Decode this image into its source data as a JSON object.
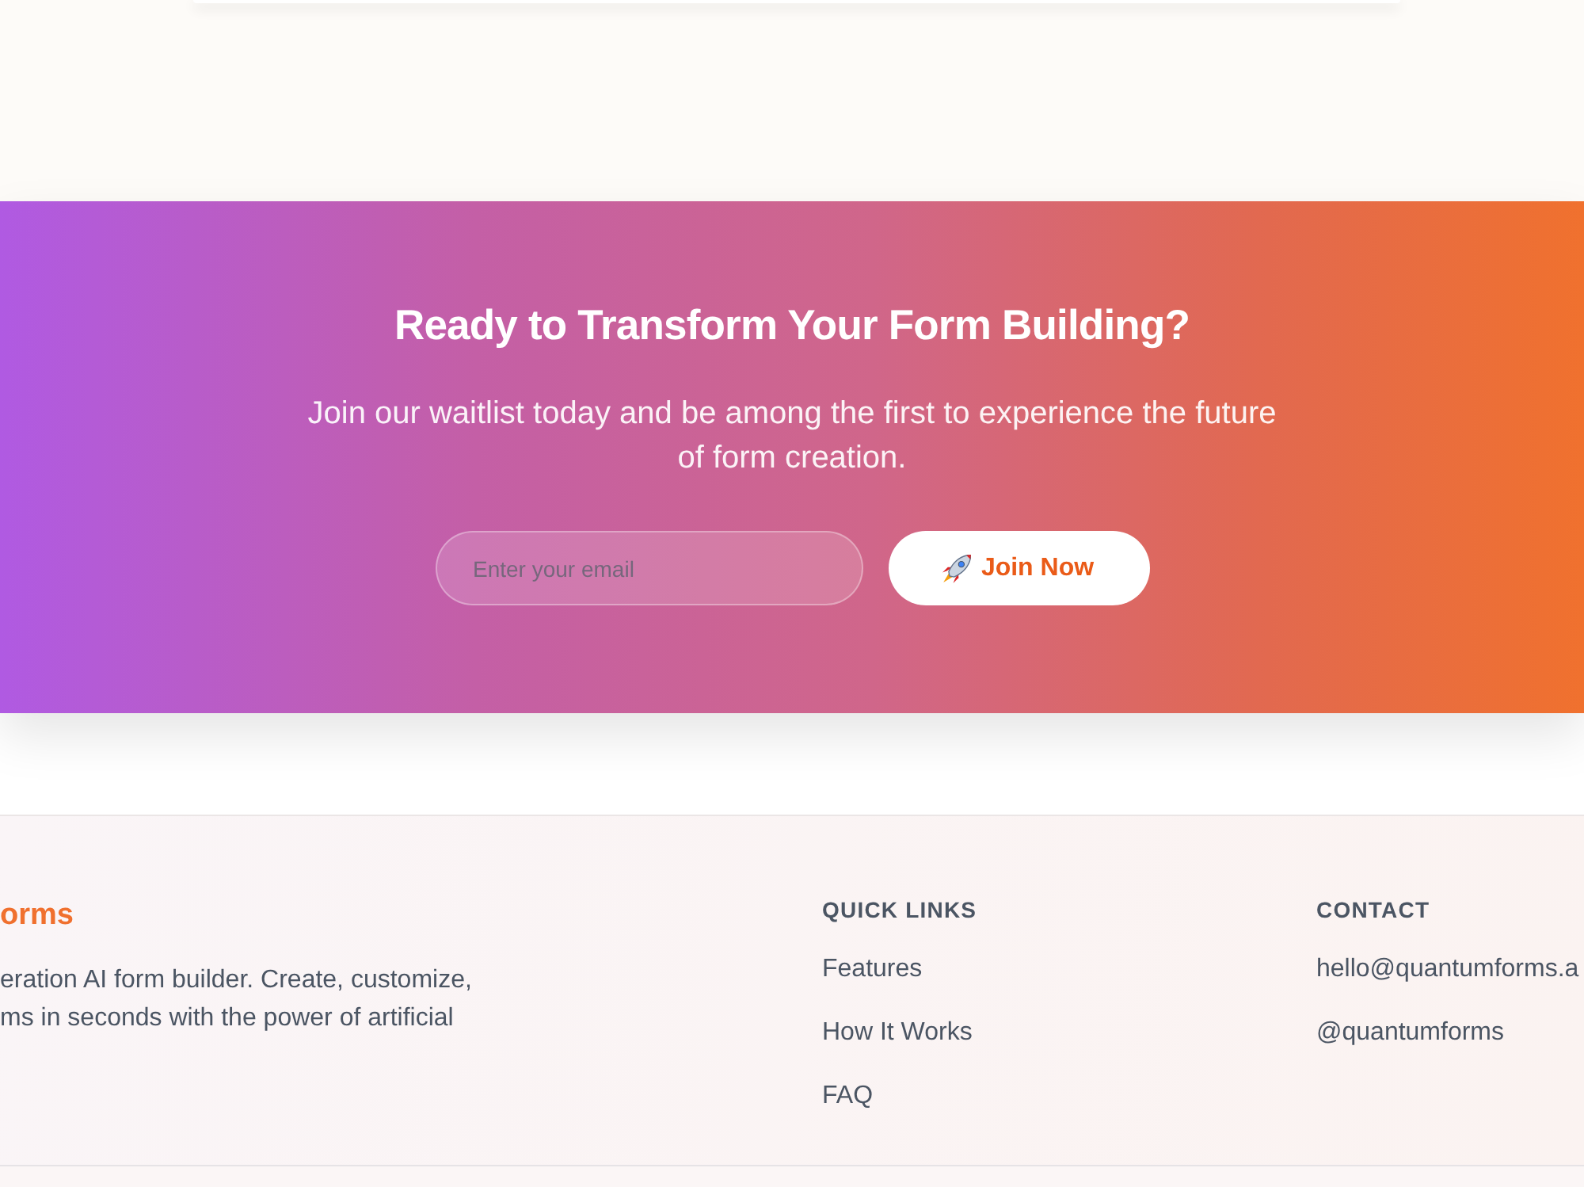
{
  "cta": {
    "title": "Ready to Transform Your Form Building?",
    "subtitle": "Join our waitlist today and be among the first to experience the future of form creation.",
    "email_field": {
      "placeholder": "Enter your email"
    },
    "join_button": {
      "label": "Join Now"
    }
  },
  "footer": {
    "brand": "orms",
    "description_lines": [
      "eration AI form builder. Create, customize,",
      "ms in seconds with the power of artificial"
    ],
    "columns": [
      {
        "heading": "QUICK LINKS",
        "links": [
          "Features",
          "How It Works",
          "FAQ"
        ]
      },
      {
        "heading": "CONTACT",
        "links": [
          "hello@quantumforms.a",
          "@quantumforms"
        ]
      }
    ]
  }
}
